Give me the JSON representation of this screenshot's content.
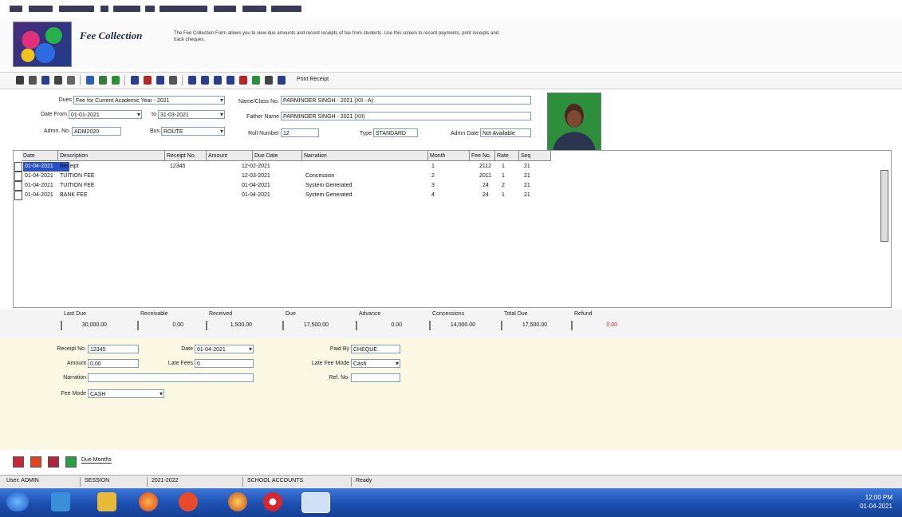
{
  "header": {
    "title": "Fee Collection",
    "description": "The Fee Collection Form allows you to view due amounts and record receipts of fee from students. Use this screen to record payments, print receipts and track cheques."
  },
  "toolbar": {
    "receipt_label": "Print Receipt"
  },
  "filters": {
    "dues_label": "Dues",
    "dues_value": "Fee for Current Academic Year - 2021",
    "date_from_label": "Date From",
    "date_from_value": "01-01-2021",
    "to_label": "to",
    "date_to_value": "31-03-2021",
    "admin_no_label": "Admn. No.",
    "admin_no_value": "ADM2020",
    "bus_label": "Bus",
    "bus_value": "ROUTE"
  },
  "student": {
    "name_label": "Name/Class No.",
    "name_value": "PARMINDER SINGH - 2021 (XII - A)",
    "father_label": "Father Name",
    "father_value": "PARMINDER SINGH - 2021 (XII)",
    "roll_label": "Roll Number",
    "roll_value": "12",
    "type_label": "Type",
    "type_value": "STANDARD",
    "admin_date_label": "Admn Date",
    "admin_date_value": "Not Available"
  },
  "grid": {
    "columns": [
      "Date",
      "Description",
      "Receipt No.",
      "Amount",
      "Due Date",
      "Narration",
      "Month",
      "Fee No.",
      "Rate",
      "Seq"
    ],
    "rows": [
      {
        "date": "01-04-2021",
        "description": "Receipt",
        "receipt": "12345",
        "amount": "",
        "due": "12-02-2021",
        "narration": "",
        "month": "1",
        "feeno": "2112",
        "rate": "1",
        "seq": "21"
      },
      {
        "date": "01-04-2021",
        "description": "TUITION FEE",
        "receipt": "",
        "amount": "",
        "due": "12-03-2021",
        "narration": "Concession",
        "month": "2",
        "feeno": "2011",
        "rate": "1",
        "seq": "21"
      },
      {
        "date": "01-04-2021",
        "description": "TUITION FEE",
        "receipt": "",
        "amount": "",
        "due": "01-04-2021",
        "narration": "System Generated",
        "month": "3",
        "feeno": "24",
        "rate": "2",
        "seq": "21"
      },
      {
        "date": "01-04-2021",
        "description": "BANK FEE",
        "receipt": "",
        "amount": "",
        "due": "01-04-2021",
        "narration": "System Generated",
        "month": "4",
        "feeno": "24",
        "rate": "1",
        "seq": "21"
      }
    ]
  },
  "totals": [
    {
      "label": "Last Due",
      "value": "30,000.00"
    },
    {
      "label": "Receivable",
      "value": "0.00"
    },
    {
      "label": "Received",
      "value": "1,500.00"
    },
    {
      "label": "Due",
      "value": "17,500.00"
    },
    {
      "label": "Advance",
      "value": "0.00"
    },
    {
      "label": "Concessions",
      "value": "14,000.00"
    },
    {
      "label": "Total Due",
      "value": "17,500.00"
    },
    {
      "label": "Refund",
      "value": "0.00"
    }
  ],
  "receipt_form": {
    "receipt_no_label": "Receipt No.",
    "receipt_no_value": "12345",
    "date_label": "Date",
    "date_value": "01-04-2021",
    "paid_by_label": "Paid By",
    "paid_by_value": "CHEQUE",
    "amount_label": "Amount",
    "amount_value": "0.00",
    "late_fees_label": "Late Fees",
    "late_fees_value": "0",
    "late_fee_mode_label": "Late Fee Mode",
    "late_fee_mode_value": "Cash",
    "narration_label": "Narration",
    "narration_value": "",
    "ref_no_label": "Ref. No.",
    "ref_no_value": "",
    "fee_mode_label": "Fee Mode",
    "fee_mode_value": "CASH"
  },
  "legend": {
    "label": "Due Months"
  },
  "statusbar": {
    "items": [
      "User: ADMIN",
      "SESSION",
      "2021-2022",
      "SCHOOL ACCOUNTS",
      "Ready"
    ]
  },
  "taskbar": {
    "time": "12:00 PM",
    "date": "01-04-2021"
  },
  "colors": {
    "accent": "#2a50c8",
    "taskbar": "#1c4fb0",
    "panel": "#fbf8e4",
    "photo_bg": "#2d8f3b"
  }
}
